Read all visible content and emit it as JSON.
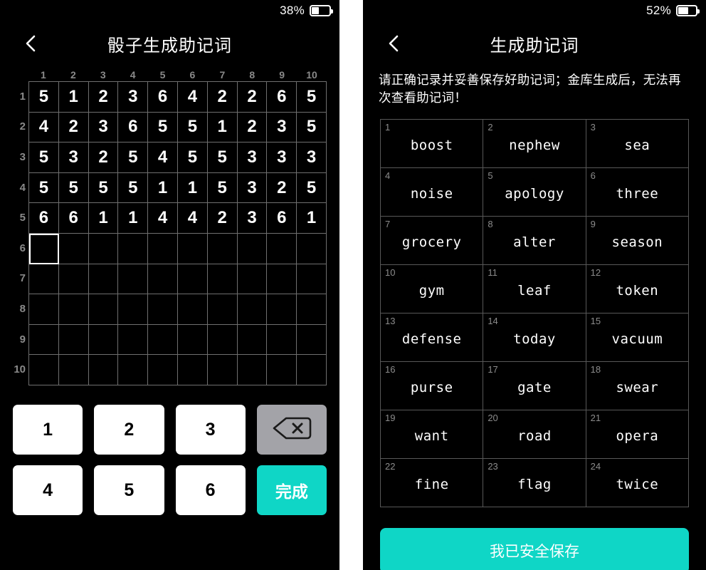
{
  "theme": {
    "accent": "#0fd6c6",
    "background": "#000000",
    "key_face": "#ffffff",
    "backspace_key": "#a3a3a8",
    "grid_line": "#6f6f6f",
    "word_grid_line": "#585858",
    "muted_text": "#8a8a8a"
  },
  "left_panel": {
    "status": {
      "battery_percent": "38%",
      "battery_level": 38
    },
    "nav": {
      "title": "骰子生成助记词",
      "back_icon": "chevron-left-icon"
    },
    "dice": {
      "column_headers": [
        "1",
        "2",
        "3",
        "4",
        "5",
        "6",
        "7",
        "8",
        "9",
        "10"
      ],
      "row_headers": [
        "1",
        "2",
        "3",
        "4",
        "5",
        "6",
        "7",
        "8",
        "9",
        "10"
      ],
      "rows": [
        [
          "5",
          "1",
          "2",
          "3",
          "6",
          "4",
          "2",
          "2",
          "6",
          "5"
        ],
        [
          "4",
          "2",
          "3",
          "6",
          "5",
          "5",
          "1",
          "2",
          "3",
          "5"
        ],
        [
          "5",
          "3",
          "2",
          "5",
          "4",
          "5",
          "5",
          "3",
          "3",
          "3"
        ],
        [
          "5",
          "5",
          "5",
          "5",
          "1",
          "1",
          "5",
          "3",
          "2",
          "5"
        ],
        [
          "6",
          "6",
          "1",
          "1",
          "4",
          "4",
          "2",
          "3",
          "6",
          "1"
        ],
        [
          "",
          "",
          "",
          "",
          "",
          "",
          "",
          "",
          "",
          ""
        ],
        [
          "",
          "",
          "",
          "",
          "",
          "",
          "",
          "",
          "",
          ""
        ],
        [
          "",
          "",
          "",
          "",
          "",
          "",
          "",
          "",
          "",
          ""
        ],
        [
          "",
          "",
          "",
          "",
          "",
          "",
          "",
          "",
          "",
          ""
        ],
        [
          "",
          "",
          "",
          "",
          "",
          "",
          "",
          "",
          "",
          ""
        ]
      ],
      "cursor": {
        "row": 6,
        "column": 1
      }
    },
    "keypad": {
      "keys": [
        "1",
        "2",
        "3"
      ],
      "keys_row2": [
        "4",
        "5",
        "6"
      ],
      "backspace_icon": "backspace-icon",
      "done_label": "完成"
    }
  },
  "right_panel": {
    "status": {
      "battery_percent": "52%",
      "battery_level": 52
    },
    "nav": {
      "title": "生成助记词",
      "back_icon": "chevron-left-icon"
    },
    "notice": "请正确记录并妥善保存好助记词；金库生成后，无法再次查看助记词！",
    "mnemonic": {
      "count": 24,
      "words": [
        {
          "index": "1",
          "word": "boost"
        },
        {
          "index": "2",
          "word": "nephew"
        },
        {
          "index": "3",
          "word": "sea"
        },
        {
          "index": "4",
          "word": "noise"
        },
        {
          "index": "5",
          "word": "apology"
        },
        {
          "index": "6",
          "word": "three"
        },
        {
          "index": "7",
          "word": "grocery"
        },
        {
          "index": "8",
          "word": "alter"
        },
        {
          "index": "9",
          "word": "season"
        },
        {
          "index": "10",
          "word": "gym"
        },
        {
          "index": "11",
          "word": "leaf"
        },
        {
          "index": "12",
          "word": "token"
        },
        {
          "index": "13",
          "word": "defense"
        },
        {
          "index": "14",
          "word": "today"
        },
        {
          "index": "15",
          "word": "vacuum"
        },
        {
          "index": "16",
          "word": "purse"
        },
        {
          "index": "17",
          "word": "gate"
        },
        {
          "index": "18",
          "word": "swear"
        },
        {
          "index": "19",
          "word": "want"
        },
        {
          "index": "20",
          "word": "road"
        },
        {
          "index": "21",
          "word": "opera"
        },
        {
          "index": "22",
          "word": "fine"
        },
        {
          "index": "23",
          "word": "flag"
        },
        {
          "index": "24",
          "word": "twice"
        }
      ]
    },
    "save_button_label": "我已安全保存"
  }
}
